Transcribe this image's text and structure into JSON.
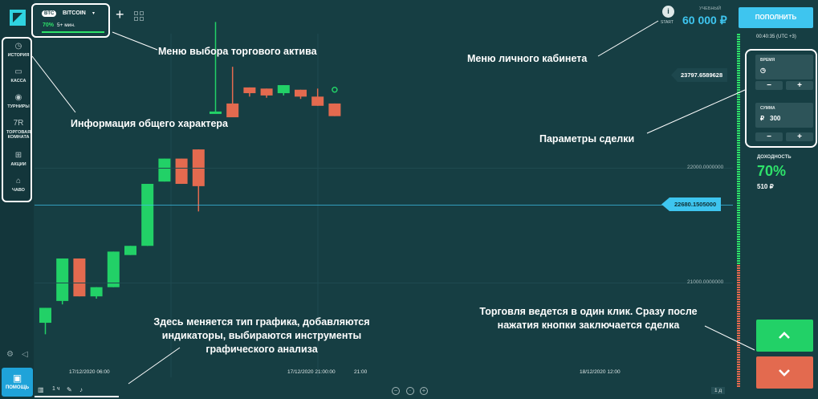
{
  "sidebar": {
    "items": [
      {
        "icon": "history-icon",
        "glyph": "◷",
        "label": "ИСТОРИЯ"
      },
      {
        "icon": "wallet-icon",
        "glyph": "▭",
        "label": "КАССА"
      },
      {
        "icon": "tournament-icon",
        "glyph": "◉",
        "label": "ТУРНИРЫ"
      },
      {
        "icon": "trading-room-icon",
        "glyph": "7R",
        "label": "ТОРГОВАЯ КОМНАТА"
      },
      {
        "icon": "gift-icon",
        "glyph": "⊞",
        "label": "АКЦИИ"
      },
      {
        "icon": "faq-icon",
        "glyph": "⌂",
        "label": "ЧАВО"
      }
    ],
    "help_label": "ПОМОЩЬ"
  },
  "asset": {
    "badge": "BTC",
    "name": "BITCOIN",
    "payout": "70%",
    "expiry": "5+ мин."
  },
  "account": {
    "start_label": "START",
    "type": "УЧЕБНЫЙ",
    "balance": "60 000 ₽",
    "deposit_label": "ПОПОЛНИТЬ",
    "clock": "00:40:35 (UTC +3)"
  },
  "trade": {
    "time_label": "ВРЕМЯ",
    "sum_label": "СУММА",
    "currency": "₽",
    "sum_value": "300",
    "minus": "−",
    "plus": "+",
    "yield_label": "ДОХОДНОСТЬ",
    "yield_pct": "70%",
    "yield_amount": "510 ₽"
  },
  "chart": {
    "last_price_label": "23797.6589628",
    "current_price_label": "22680.1505000",
    "axis_levels": [
      "22000.0000000",
      "21000.0000000"
    ],
    "time_labels": [
      "17/12/2020 06:00",
      "17/12/2020 21:00:00",
      "21:00",
      "18/12/2020 12:00"
    ],
    "period": "1 д",
    "interval": "1 ч"
  },
  "annotations": {
    "asset_menu": "Меню выбора торгового актива",
    "account_menu": "Меню личного кабинета",
    "general_info": "Информация общего характера",
    "trade_params": "Параметры сделки",
    "chart_tools": "Здесь меняется тип графика, добавляются индикаторы, выбираются инструменты графического анализа",
    "one_click": "Торговля ведется в один клик. Сразу после нажатия кнопки заключается сделка"
  },
  "colors": {
    "background": "#163e43",
    "bull": "#22d167",
    "bear": "#e36a4f",
    "accent": "#3ec5ef"
  },
  "chart_data": {
    "type": "candlestick",
    "y_unit": "price",
    "levels": [
      22000,
      21000
    ],
    "current_price": 22680.1505,
    "last_high_price": 23797.6589628,
    "candles": [
      {
        "o": 20650,
        "h": 20780,
        "l": 20550,
        "c": 20780
      },
      {
        "o": 20840,
        "h": 21210,
        "l": 20810,
        "c": 21210
      },
      {
        "o": 21210,
        "h": 21210,
        "l": 20880,
        "c": 20880
      },
      {
        "o": 20880,
        "h": 20960,
        "l": 20860,
        "c": 20960
      },
      {
        "o": 20960,
        "h": 21270,
        "l": 20960,
        "c": 21270
      },
      {
        "o": 21240,
        "h": 21320,
        "l": 21240,
        "c": 21320
      },
      {
        "o": 21320,
        "h": 21860,
        "l": 21320,
        "c": 21860
      },
      {
        "o": 21880,
        "h": 22080,
        "l": 21880,
        "c": 22080
      },
      {
        "o": 22080,
        "h": 22080,
        "l": 21860,
        "c": 21860
      },
      {
        "o": 22160,
        "h": 22160,
        "l": 21620,
        "c": 21840
      },
      {
        "o": 22490,
        "h": 23270,
        "l": 22490,
        "c": 22490
      },
      {
        "o": 22560,
        "h": 22880,
        "l": 22460,
        "c": 22440
      },
      {
        "o": 22700,
        "h": 22700,
        "l": 22620,
        "c": 22650
      },
      {
        "o": 22690,
        "h": 22690,
        "l": 22610,
        "c": 22630
      },
      {
        "o": 22650,
        "h": 22720,
        "l": 22630,
        "c": 22720
      },
      {
        "o": 22680,
        "h": 22680,
        "l": 22600,
        "c": 22620
      },
      {
        "o": 22620,
        "h": 22690,
        "l": 22540,
        "c": 22540
      },
      {
        "o": 22560,
        "h": 22560,
        "l": 22450,
        "c": 22450
      }
    ]
  }
}
